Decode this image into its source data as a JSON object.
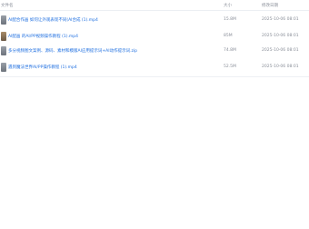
{
  "header": {
    "name_label": "文件名",
    "size_label": "大小",
    "date_label": "修改日期"
  },
  "files": [
    {
      "name": "AI配合作画 如何让外观表现不同(AI合成 (1).mp4",
      "size": "15.8M",
      "date": "2025-10-06 08:01",
      "thumb": "gray"
    },
    {
      "name": "AI配画 的AI/PP视频操作教程 (1).mp4",
      "size": "85M",
      "date": "2025-10-06 08:01",
      "thumb": "brown"
    },
    {
      "name": "多分视频图文案例、源码、素材和模版AI应用提示词+AI动作提示词.zip",
      "size": "74.8M",
      "date": "2025-10-06 08:01",
      "thumb": "gray"
    },
    {
      "name": "遇到魔法世界AI/PP操作教程 (1).mp4",
      "size": "52.5M",
      "date": "2025-10-06 08:01",
      "thumb": "gray"
    }
  ]
}
